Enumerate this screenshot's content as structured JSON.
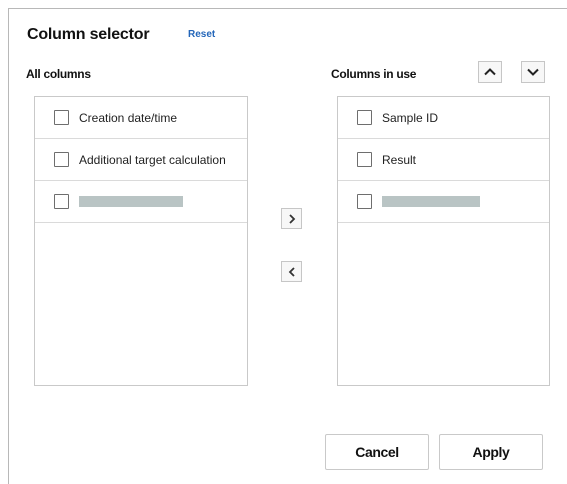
{
  "dialog": {
    "title": "Column selector",
    "reset_label": "Reset"
  },
  "all_columns": {
    "heading": "All columns",
    "items": [
      {
        "label": "Creation date/time",
        "checked": false
      },
      {
        "label": "Additional target calculation",
        "checked": false
      },
      {
        "label": "",
        "checked": false
      }
    ]
  },
  "columns_in_use": {
    "heading": "Columns in use",
    "items": [
      {
        "label": "Sample ID",
        "checked": false
      },
      {
        "label": "Result",
        "checked": false
      },
      {
        "label": "",
        "checked": false
      }
    ]
  },
  "transfer": {
    "add_icon": "chevron-right-icon",
    "remove_icon": "chevron-left-icon"
  },
  "reorder": {
    "up_icon": "chevron-up-icon",
    "down_icon": "chevron-down-icon"
  },
  "footer": {
    "cancel_label": "Cancel",
    "apply_label": "Apply"
  },
  "colors": {
    "link": "#2466b9",
    "redacted_bar": "#b9c4c4",
    "border": "#c9c9c9"
  }
}
